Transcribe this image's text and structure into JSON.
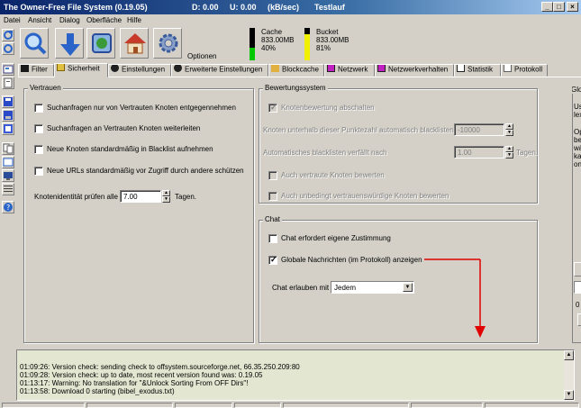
{
  "window": {
    "title": "The Owner-Free File System (0.19.05)",
    "downstat": "D: 0.00",
    "upstat": "U: 0.00",
    "unit": "(kB/sec)",
    "mode": "Testlauf",
    "controls": [
      "_",
      "□",
      "×"
    ]
  },
  "menu": [
    "Datei",
    "Ansicht",
    "Dialog",
    "Oberfläche",
    "Hilfe"
  ],
  "toolbar": {
    "options_label": "Optionen",
    "cache": {
      "label": "Cache",
      "size": "833.00MB",
      "percent": "40%",
      "fill": 0.4
    },
    "bucket": {
      "label": "Bucket",
      "size": "833.00MB",
      "percent": "81%",
      "fill": 0.81
    }
  },
  "tabs": [
    {
      "label": "Filter"
    },
    {
      "label": "Sicherheit"
    },
    {
      "label": "Einstellungen"
    },
    {
      "label": "Erweiterte Einstellungen"
    },
    {
      "label": "Blockcache"
    },
    {
      "label": "Netzwerk"
    },
    {
      "label": "Netzwerkverhalten"
    },
    {
      "label": "Statistik"
    },
    {
      "label": "Protokoll"
    }
  ],
  "trust": {
    "legend": "Vertrauen",
    "options": [
      "Suchanfragen nur von Vertrauten Knoten entgegennehmen",
      "Suchanfragen an Vertrauten Knoten weiterleiten",
      "Neue Knoten standardmäßig in Blacklist aufnehmen",
      "Neue URLs standardmäßig vor Zugriff durch andere schützen"
    ],
    "check_label": "Knotenidentität prüfen alle",
    "check_value": "7.00",
    "check_unit": "Tagen."
  },
  "rating": {
    "legend": "Bewertungssystem",
    "disable_label": "Knotenbewertung abschalten",
    "threshold_label": "Knoten unterhalb dieser Punktezahl automatisch blacklisten",
    "threshold_value": "-10000",
    "auto_label": "Automatisches blacklisten verfällt nach",
    "auto_value": "1.00",
    "auto_unit": "Tagen.",
    "trusted_label": "Auch vertraute Knoten bewerten",
    "always_trust_label": "Auch unbedingt vertrauenswürdige Knoten bewerten"
  },
  "chat": {
    "legend": "Chat",
    "consent_label": "Chat erfordert eigene Zustimmung",
    "global_label": "Globale Nachrichten (im Protokoll) anzeigen",
    "allow_label": "Chat erlauben mit",
    "allow_value": "Jedem"
  },
  "right_stub": {
    "legend": "Globa",
    "lines": [
      "Use",
      "lexe",
      "",
      "Opt",
      "bes",
      "wäh",
      "kath",
      "one"
    ],
    "btn": "S",
    "zero": "0"
  },
  "log": [
    "01:09:26:  Version check: sending check to offsystem.sourceforge.net, 66.35.250.209:80",
    "01:09:28:  Version check: up to date, most recent version found was: 0.19.05",
    "01:13:17:  Warning: No translation for \"&Unlock Sorting From OFF Dirs\"!",
    "01:13:58:  Download 0 starting (bibel_exodus.txt)"
  ],
  "colors": {
    "arrow": "#e00000",
    "titlebar": "#0a246a",
    "log_bg": "#e3e6d0",
    "bar_green": "#00c800",
    "bar_yellow": "#f0f000"
  }
}
